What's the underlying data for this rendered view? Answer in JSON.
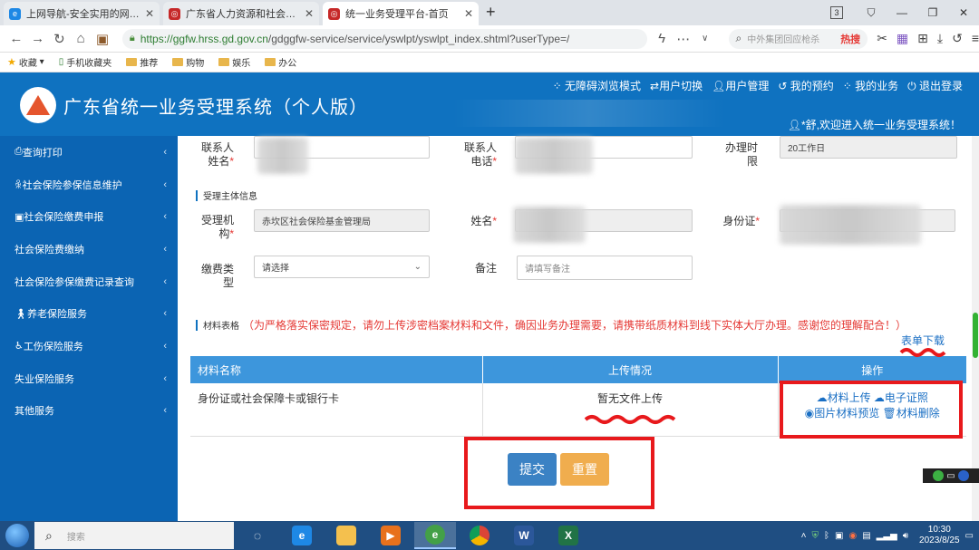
{
  "browser": {
    "tabs": [
      {
        "label": "上网导航-安全实用的网址导航",
        "active": false,
        "color": "#1e88e5"
      },
      {
        "label": "广东省人力资源和社会保障厅官",
        "active": false,
        "color": "#c62828"
      },
      {
        "label": "统一业务受理平台-首页",
        "active": true,
        "color": "#c62828"
      }
    ],
    "new_tab": "+",
    "hrs_badge": "3",
    "url_https": "https://",
    "url_host": "ggfw.hrss.gd.gov.cn",
    "url_path": "/gdggfw-service/service/yswlpt/yswlpt_index.shtml?userType=/",
    "search_placeholder": "中外集团回应枪杀",
    "search_hot": "热搜",
    "bookmarks": [
      "收藏",
      "手机收藏夹",
      "推荐",
      "购物",
      "娱乐",
      "办公"
    ]
  },
  "header": {
    "title": "广东省统一业务受理系统（个人版）",
    "links": [
      "无障碍浏览模式",
      "用户切换",
      "用户管理",
      "我的预约",
      "我的业务",
      "退出登录"
    ],
    "welcome": "*舒,欢迎进入统一业务受理系统！"
  },
  "sidebar": {
    "items": [
      {
        "label": "查询打印"
      },
      {
        "label": "社会保险参保信息维护"
      },
      {
        "label": "社会保险缴费申报"
      },
      {
        "label": "社会保险费缴纳"
      },
      {
        "label": "社会保险参保缴费记录查询"
      },
      {
        "label": "养老保险服务"
      },
      {
        "label": "工伤保险服务"
      },
      {
        "label": "失业保险服务"
      },
      {
        "label": "其他服务"
      }
    ]
  },
  "form": {
    "contact_name_label": "联系人姓名",
    "contact_phone_label": "联系人电话",
    "time_limit_label": "办理时限",
    "time_limit_value": "20工作日",
    "subject_section": "受理主体信息",
    "agency_label": "受理机构",
    "agency_value": "赤坎区社会保险基金管理局",
    "name_label": "姓名",
    "id_label": "身份证",
    "payment_type_label": "缴费类型",
    "payment_type_value": "请选择",
    "remark_label": "备注",
    "remark_placeholder": "请填写备注"
  },
  "materials": {
    "section": "材料表格",
    "warning": "（为严格落实保密规定，请勿上传涉密档案材料和文件，确因业务办理需要，请携带纸质材料到线下实体大厅办理。感谢您的理解配合！）",
    "download": "表单下载",
    "headers": [
      "材料名称",
      "上传情况",
      "操作"
    ],
    "rows": [
      {
        "name": "身份证或社会保障卡或银行卡",
        "status": "暂无文件上传"
      }
    ],
    "ops": [
      "材料上传",
      "电子证照",
      "图片材料预览",
      "材料删除"
    ]
  },
  "buttons": {
    "submit": "提交",
    "reset": "重置"
  },
  "taskbar": {
    "search_placeholder": "搜索",
    "time": "10:30",
    "date": "2023/8/25"
  }
}
